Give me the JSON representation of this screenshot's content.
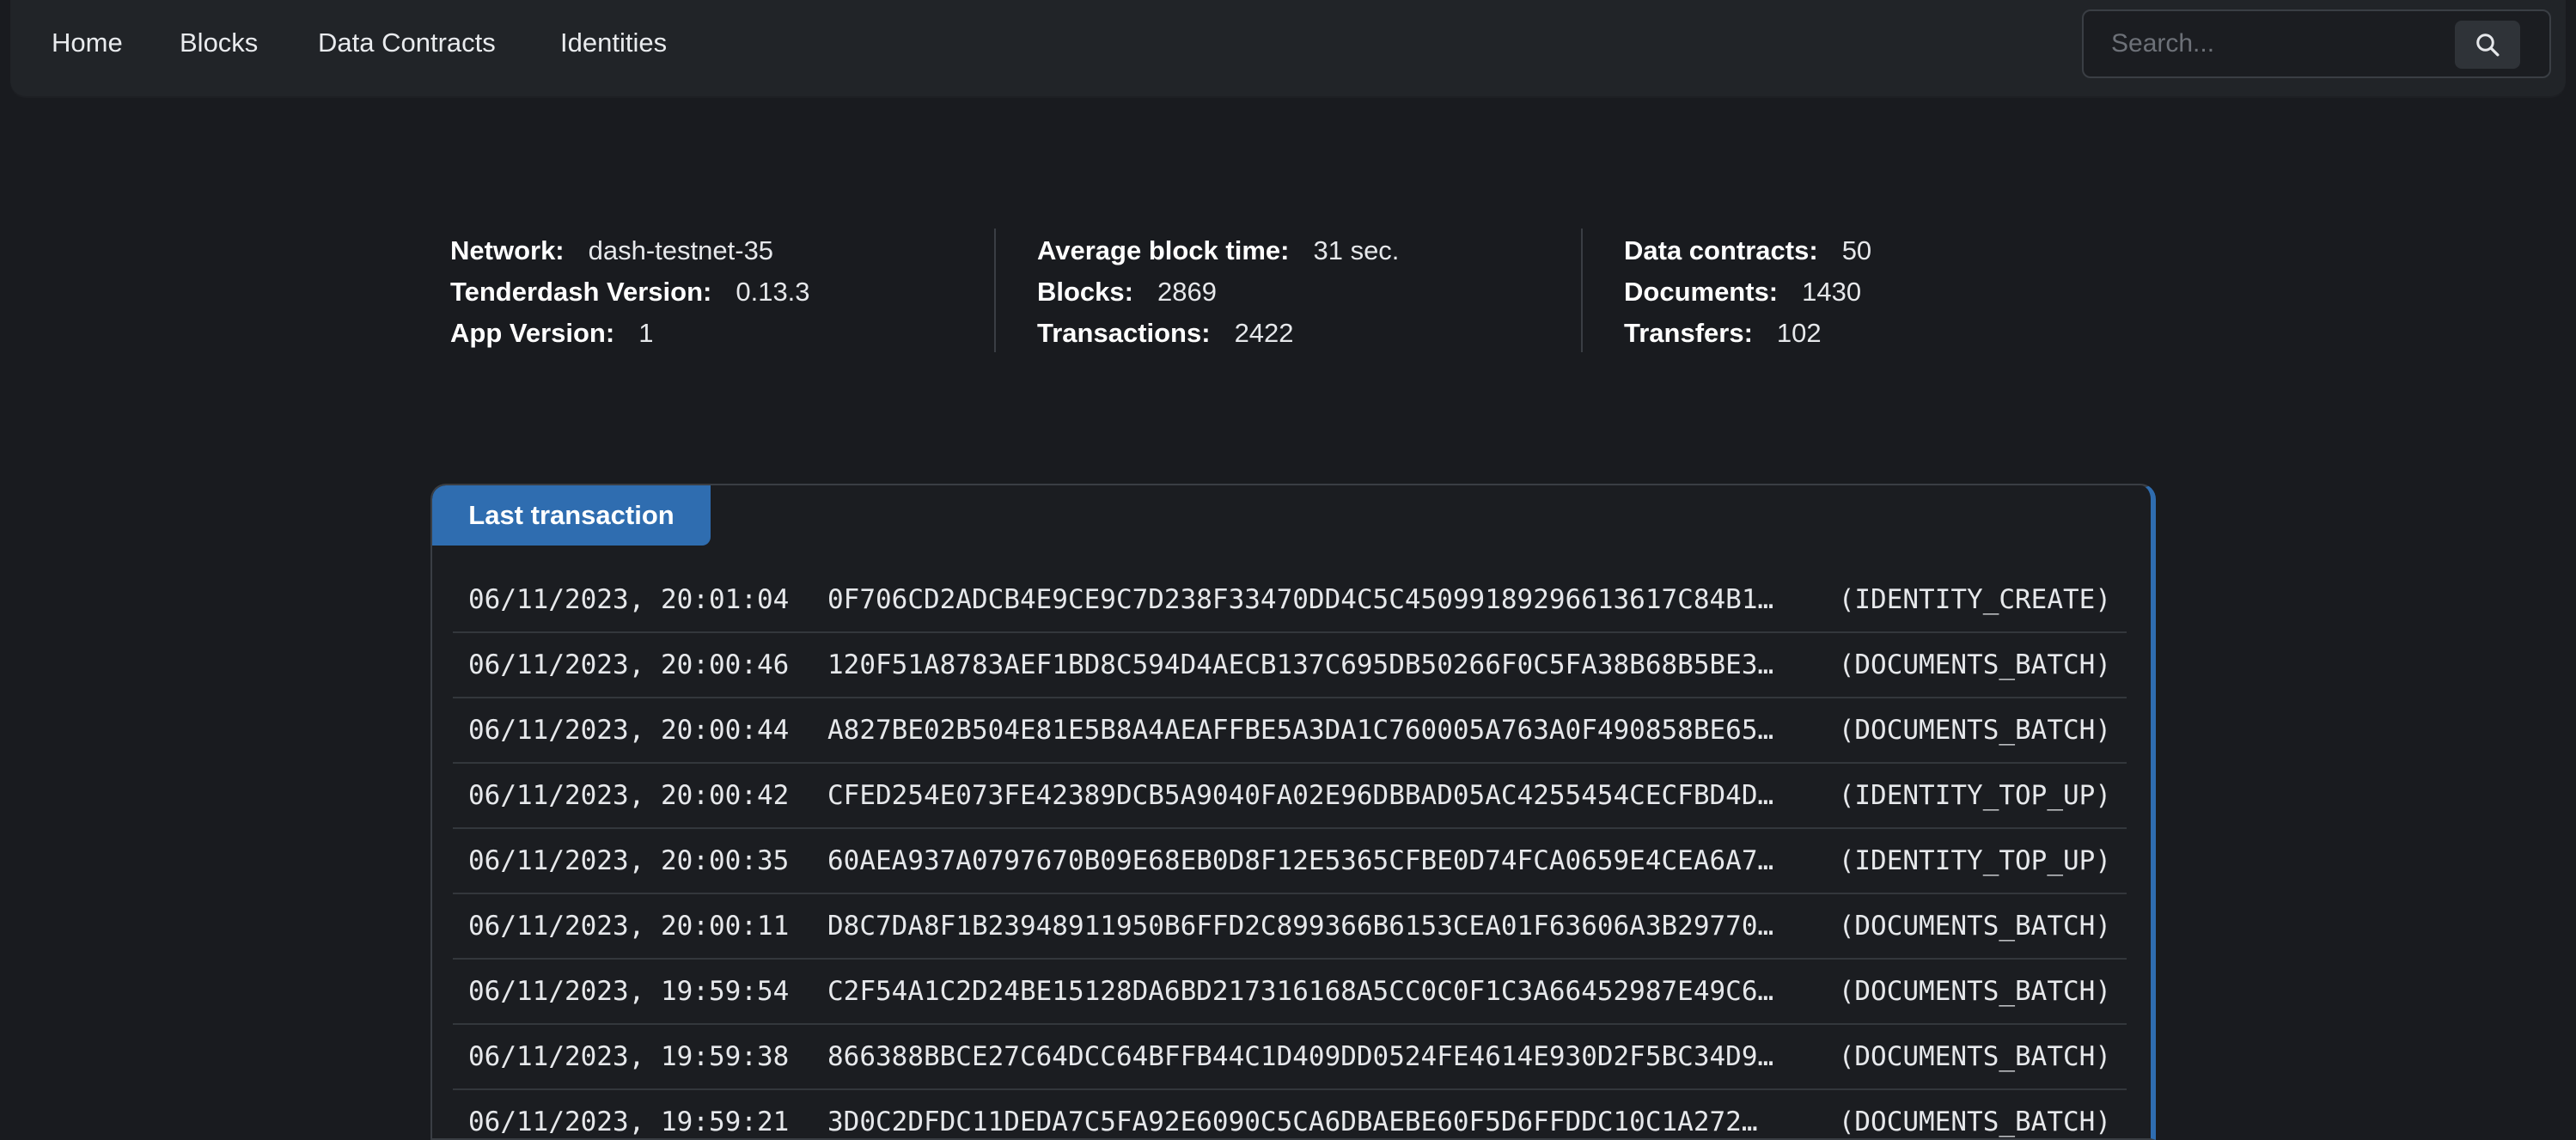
{
  "nav": {
    "items": [
      {
        "label": "Home"
      },
      {
        "label": "Blocks"
      },
      {
        "label": "Data Contracts"
      },
      {
        "label": "Identities"
      }
    ],
    "search_placeholder": "Search..."
  },
  "stats": {
    "col1": [
      {
        "label": "Network:",
        "value": "dash-testnet-35"
      },
      {
        "label": "Tenderdash Version:",
        "value": "0.13.3"
      },
      {
        "label": "App Version:",
        "value": "1"
      }
    ],
    "col2": [
      {
        "label": "Average block time:",
        "value": "31 sec."
      },
      {
        "label": "Blocks:",
        "value": "2869"
      },
      {
        "label": "Transactions:",
        "value": "2422"
      }
    ],
    "col3": [
      {
        "label": "Data contracts:",
        "value": "50"
      },
      {
        "label": "Documents:",
        "value": "1430"
      },
      {
        "label": "Transfers:",
        "value": "102"
      }
    ]
  },
  "transactions": {
    "title": "Last transaction",
    "rows": [
      {
        "time": "06/11/2023, 20:01:04",
        "hash": "0F706CD2ADCB4E9CE9C7D238F33470DD4C5C45099189296613617C84B1…",
        "type": "(IDENTITY_CREATE)"
      },
      {
        "time": "06/11/2023, 20:00:46",
        "hash": "120F51A8783AEF1BD8C594D4AECB137C695DB50266F0C5FA38B68B5BE3…",
        "type": "(DOCUMENTS_BATCH)"
      },
      {
        "time": "06/11/2023, 20:00:44",
        "hash": "A827BE02B504E81E5B8A4AEAFFBE5A3DA1C760005A763A0F490858BE65…",
        "type": "(DOCUMENTS_BATCH)"
      },
      {
        "time": "06/11/2023, 20:00:42",
        "hash": "CFED254E073FE42389DCB5A9040FA02E96DBBAD05AC4255454CECFBD4D…",
        "type": "(IDENTITY_TOP_UP)"
      },
      {
        "time": "06/11/2023, 20:00:35",
        "hash": "60AEA937A0797670B09E68EB0D8F12E5365CFBE0D74FCA0659E4CEA6A7…",
        "type": "(IDENTITY_TOP_UP)"
      },
      {
        "time": "06/11/2023, 20:00:11",
        "hash": "D8C7DA8F1B23948911950B6FFD2C899366B6153CEA01F63606A3B29770…",
        "type": "(DOCUMENTS_BATCH)"
      },
      {
        "time": "06/11/2023, 19:59:54",
        "hash": "C2F54A1C2D24BE15128DA6BD217316168A5CC0C0F1C3A66452987E49C6…",
        "type": "(DOCUMENTS_BATCH)"
      },
      {
        "time": "06/11/2023, 19:59:38",
        "hash": "866388BBCE27C64DCC64BFFB44C1D409DD0524FE4614E930D2F5BC34D9…",
        "type": "(DOCUMENTS_BATCH)"
      },
      {
        "time": "06/11/2023, 19:59:21",
        "hash": "3D0C2DFDC11DEDA7C5FA92E6090C5CA6DBAEBE60F5D6FFDDC10C1A272…",
        "type": "(DOCUMENTS_BATCH)"
      }
    ]
  }
}
